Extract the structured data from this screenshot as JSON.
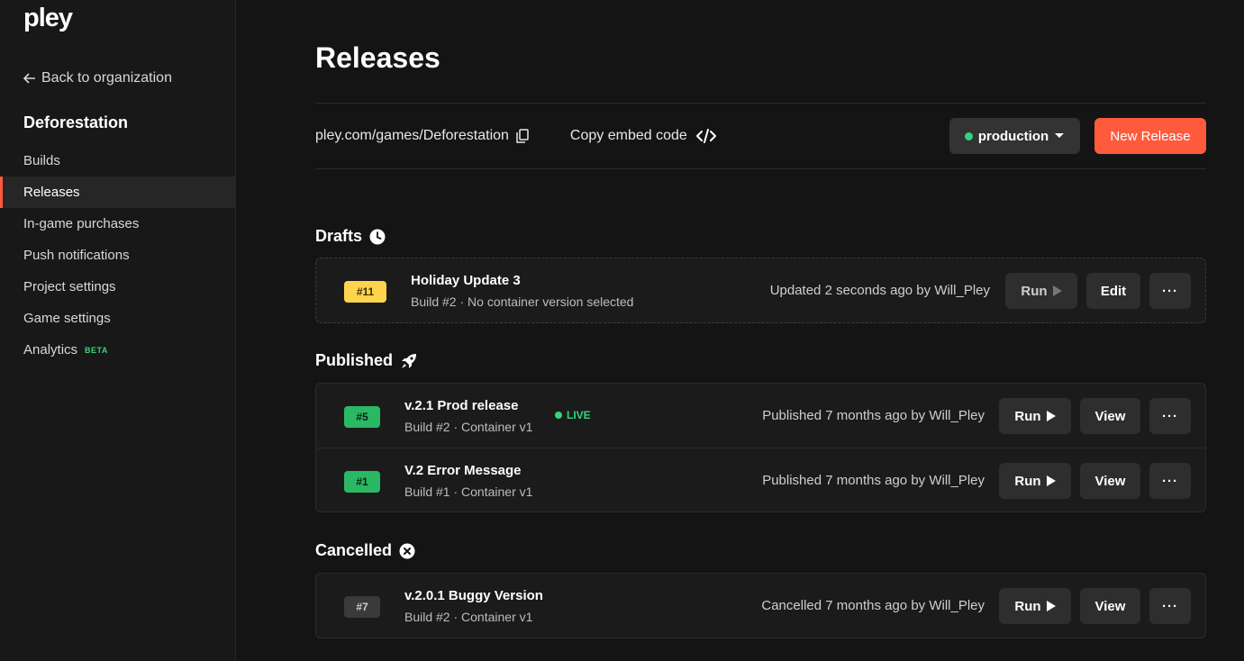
{
  "sidebar": {
    "logo": "pley",
    "back_label": "Back to organization",
    "project_name": "Deforestation",
    "items": [
      {
        "label": "Builds"
      },
      {
        "label": "Releases"
      },
      {
        "label": "In-game purchases"
      },
      {
        "label": "Push notifications"
      },
      {
        "label": "Project settings"
      },
      {
        "label": "Game settings"
      },
      {
        "label": "Analytics",
        "badge": "BETA"
      }
    ]
  },
  "page": {
    "title": "Releases"
  },
  "toolbar": {
    "url": "pley.com/games/Deforestation",
    "embed_label": "Copy embed code",
    "environment": "production",
    "new_release_label": "New Release"
  },
  "sections": {
    "drafts": "Drafts",
    "published": "Published",
    "cancelled": "Cancelled"
  },
  "drafts": [
    {
      "badge": "#11",
      "name": "Holiday Update 3",
      "sub": "Build #2 · No container version selected",
      "meta": "Updated 2 seconds ago by Will_Pley",
      "run": "Run",
      "action": "Edit",
      "more": "···"
    }
  ],
  "published": [
    {
      "badge": "#5",
      "name": "v.2.1 Prod release",
      "live": "LIVE",
      "sub": "Build #2 · Container v1",
      "meta": "Published 7 months ago by Will_Pley",
      "run": "Run",
      "action": "View",
      "more": "···"
    },
    {
      "badge": "#1",
      "name": "V.2 Error Message",
      "sub": "Build #1 · Container v1",
      "meta": "Published 7 months ago by Will_Pley",
      "run": "Run",
      "action": "View",
      "more": "···"
    }
  ],
  "cancelled": [
    {
      "badge": "#7",
      "name": "v.2.0.1 Buggy Version",
      "sub": "Build #2 · Container v1",
      "meta": "Cancelled 7 months ago by Will_Pley",
      "run": "Run",
      "action": "View",
      "more": "···"
    }
  ],
  "colors": {
    "accent": "#ff5a3c",
    "live": "#35d37a",
    "draft_badge": "#ffd44d",
    "published_badge": "#2ab865"
  }
}
